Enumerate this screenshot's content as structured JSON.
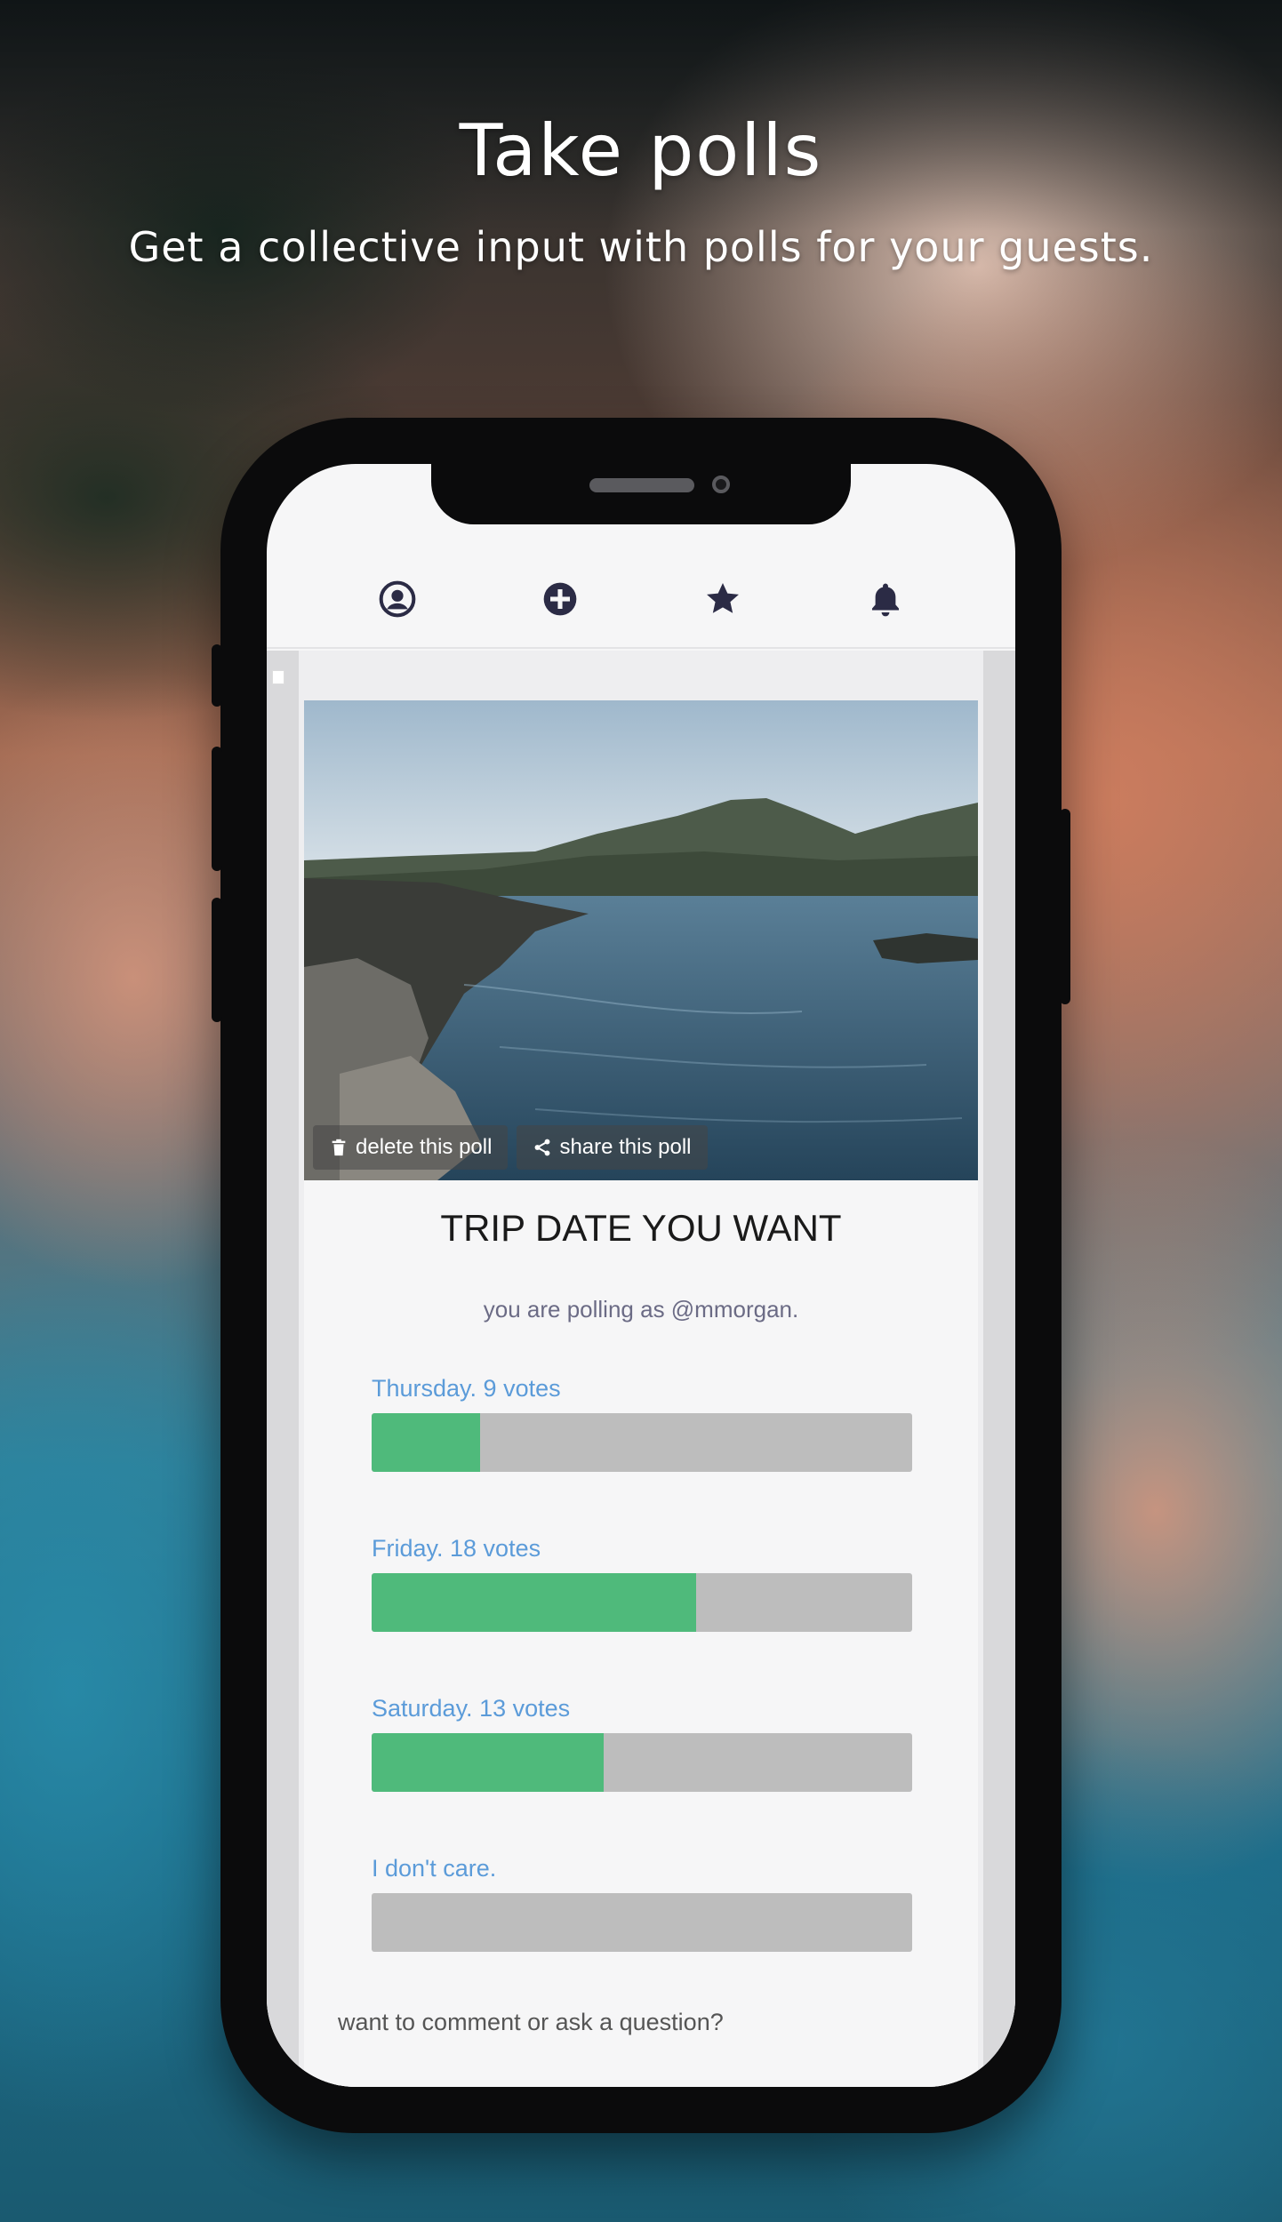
{
  "headline": {
    "title": "Take polls",
    "subtitle": "Get a collective input with polls for your guests."
  },
  "tabs": [
    {
      "name": "profile",
      "icon": "user-circle-icon"
    },
    {
      "name": "create",
      "icon": "plus-circle-icon"
    },
    {
      "name": "favorites",
      "icon": "star-icon"
    },
    {
      "name": "notifications",
      "icon": "bell-icon"
    }
  ],
  "poll": {
    "delete_label": "delete this poll",
    "share_label": "share this poll",
    "title": "TRIP DATE YOU WANT",
    "subtitle": "you are polling as @mmorgan.",
    "options": [
      {
        "label": "Thursday. 9 votes",
        "votes": 9,
        "fill_fraction": 0.2
      },
      {
        "label": "Friday. 18 votes",
        "votes": 18,
        "fill_fraction": 0.6
      },
      {
        "label": "Saturday. 13 votes",
        "votes": 13,
        "fill_fraction": 0.43
      },
      {
        "label": "I don't care.",
        "votes": 0,
        "fill_fraction": 0
      }
    ],
    "comment_prompt": "want to comment or ask a question?"
  },
  "colors": {
    "bar_fill": "#4fba7b",
    "bar_track": "#bdbdbd",
    "option_label": "#5b9bd9",
    "tab_icon": "#2b2b45"
  }
}
